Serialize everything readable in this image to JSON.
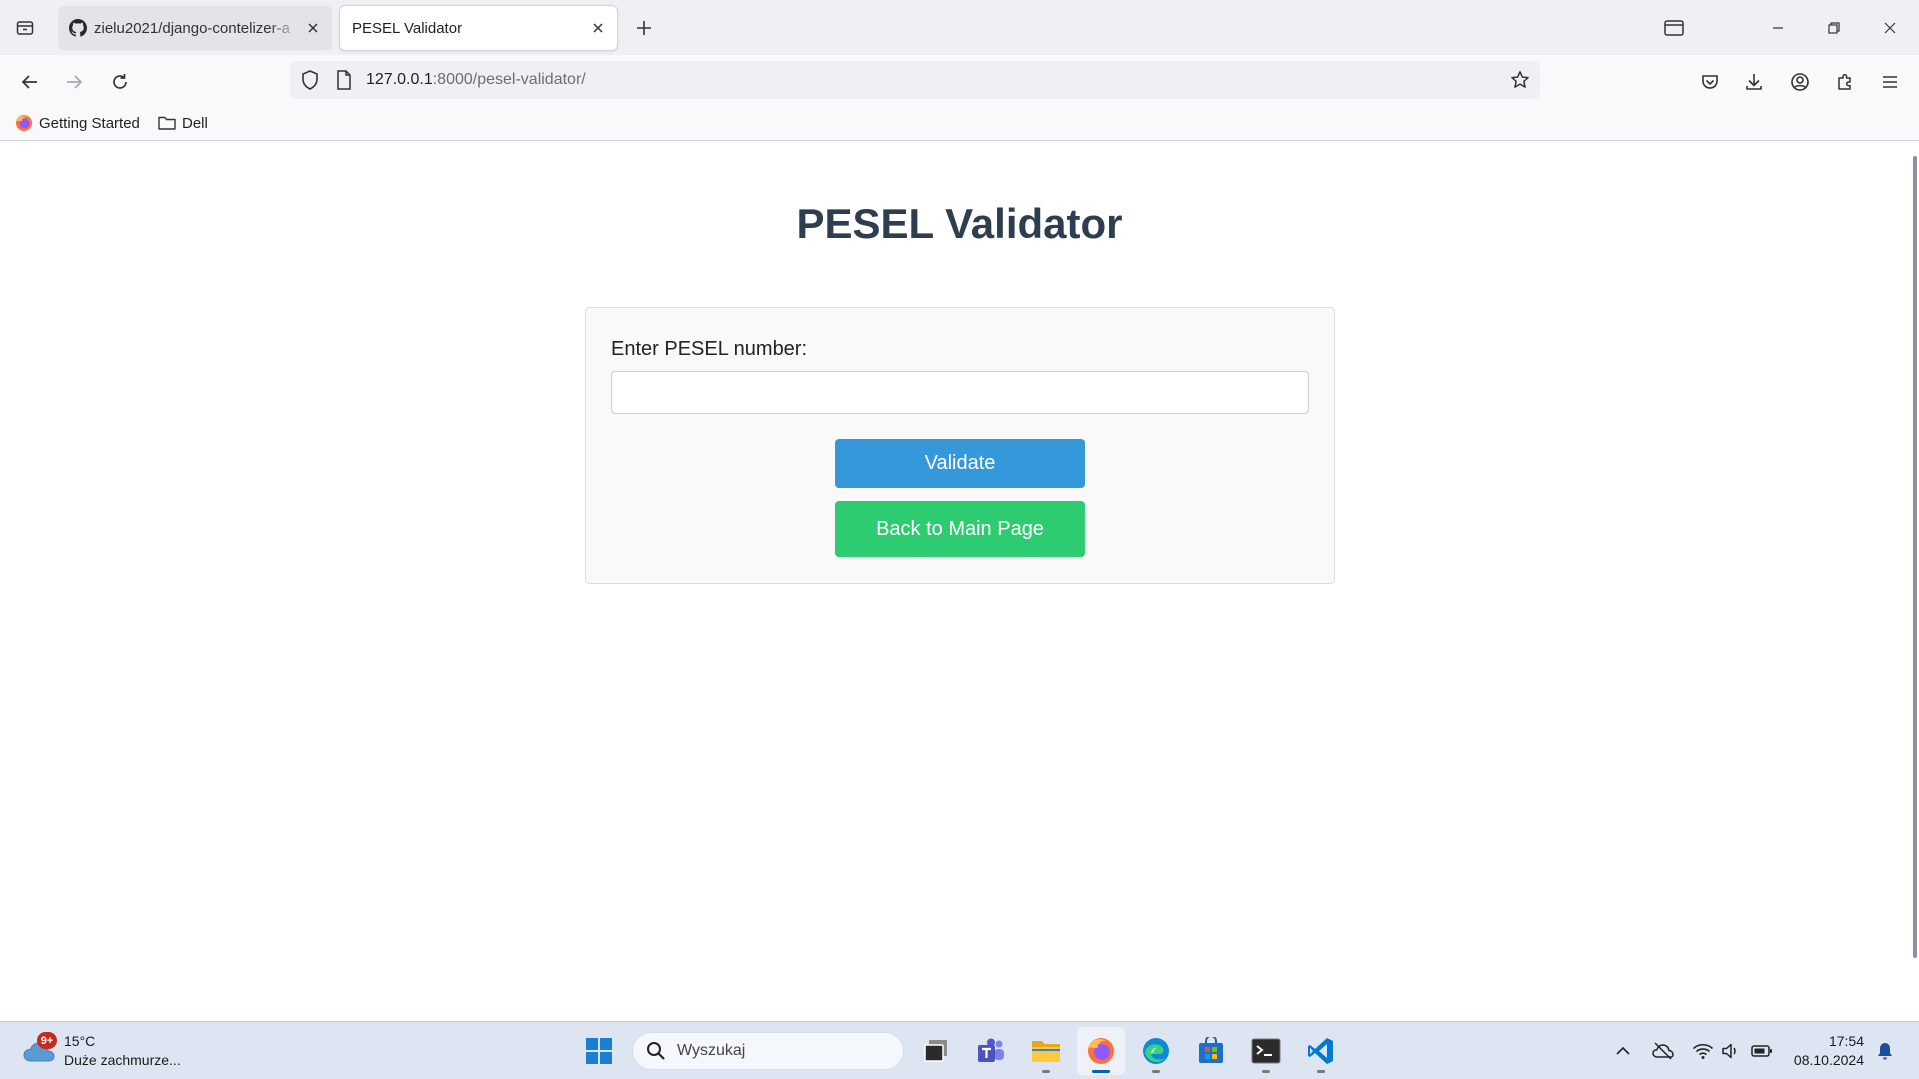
{
  "browser": {
    "tabs": [
      {
        "title": "zielu2021/django-contelizer-a",
        "active": false
      },
      {
        "title": "PESEL Validator",
        "active": true
      }
    ],
    "url": {
      "host": "127.0.0.1",
      "rest": ":8000/pesel-validator/"
    },
    "bookmarks": [
      {
        "label": "Getting Started",
        "icon": "firefox-icon"
      },
      {
        "label": "Dell",
        "icon": "folder-icon"
      }
    ]
  },
  "page": {
    "title": "PESEL Validator",
    "form": {
      "label": "Enter PESEL number:",
      "input_value": "",
      "validate_button": "Validate",
      "back_button": "Back to Main Page"
    },
    "colors": {
      "title": "#2c3e50",
      "validate": "#3498db",
      "back": "#2ecc71"
    }
  },
  "taskbar": {
    "weather": {
      "badge": "9+",
      "temp": "15°C",
      "desc": "Duże zachmurze..."
    },
    "search_placeholder": "Wyszukaj",
    "apps": [
      "start",
      "task-view",
      "teams",
      "file-explorer",
      "firefox",
      "edge",
      "store",
      "terminal",
      "vscode"
    ],
    "clock": {
      "time": "17:54",
      "date": "08.10.2024"
    }
  }
}
